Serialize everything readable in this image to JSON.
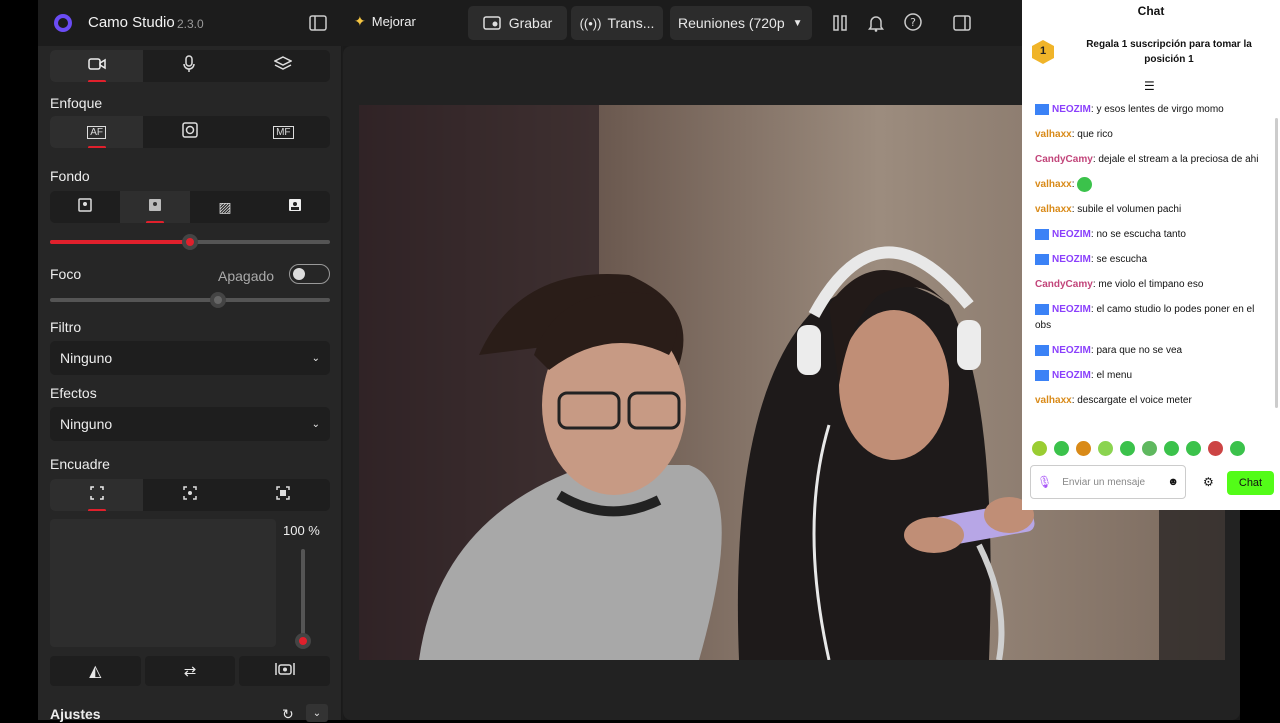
{
  "app": {
    "name": "Camo Studio",
    "version": "2.3.0"
  },
  "topbar": {
    "improve_label": "Mejorar",
    "record_label": "Grabar",
    "stream_label": "Trans...",
    "meetings_label": "Reuniones (720p"
  },
  "sidebar": {
    "focus_title": "Enfoque",
    "background_title": "Fondo",
    "focus2_title": "Foco",
    "focus2_state": "Apagado",
    "background_level": 0.5,
    "focus_level": 0.6,
    "filter_title": "Filtro",
    "filter_value": "Ninguno",
    "effects_title": "Efectos",
    "effects_value": "Ninguno",
    "framing_title": "Encuadre",
    "zoom_label": "100 %",
    "zoom_level": 0.0,
    "settings_title": "Ajustes"
  },
  "chat": {
    "title": "Chat",
    "promo_rank": "1",
    "promo_text": "Regala 1 suscripción para tomar la posición 1",
    "messages": [
      {
        "user": "NEOZIM",
        "text": "y esos lentes de virgo momo",
        "color": "#8a3ffc",
        "badge": true
      },
      {
        "user": "valhaxx",
        "text": "que rico",
        "color": "#d98a18",
        "badge": false
      },
      {
        "user": "CandyCamy",
        "text": "dejale el stream a la preciosa de ahi",
        "color": "#c2457a",
        "badge": false
      },
      {
        "user": "valhaxx",
        "text": "",
        "color": "#d98a18",
        "badge": false,
        "emote": true
      },
      {
        "user": "valhaxx",
        "text": "subile el volumen pachi",
        "color": "#d98a18",
        "badge": false
      },
      {
        "user": "NEOZIM",
        "text": "no se escucha tanto",
        "color": "#8a3ffc",
        "badge": true
      },
      {
        "user": "NEOZIM",
        "text": "se escucha",
        "color": "#8a3ffc",
        "badge": true
      },
      {
        "user": "CandyCamy",
        "text": "me violo el timpano eso",
        "color": "#c2457a",
        "badge": false
      },
      {
        "user": "NEOZIM",
        "text": "el camo studio lo podes poner en el obs",
        "color": "#8a3ffc",
        "badge": true
      },
      {
        "user": "NEOZIM",
        "text": "para que no se vea",
        "color": "#8a3ffc",
        "badge": true
      },
      {
        "user": "NEOZIM",
        "text": "el menu",
        "color": "#8a3ffc",
        "badge": true
      },
      {
        "user": "valhaxx",
        "text": "descargate el voice meter",
        "color": "#d98a18",
        "badge": false
      }
    ],
    "input_placeholder": "Enviar un mensaje",
    "send_label": "Chat"
  },
  "colors": {
    "accent": "#e0202c",
    "chat_send": "#53fc18"
  }
}
